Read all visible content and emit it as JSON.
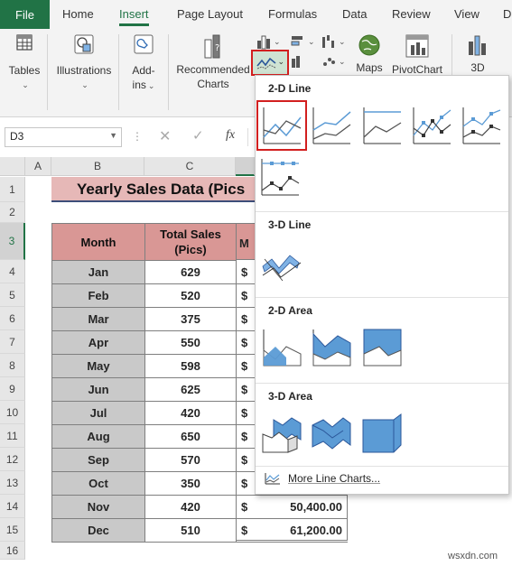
{
  "ribbon_tabs": [
    "File",
    "Home",
    "Insert",
    "Page Layout",
    "Formulas",
    "Data",
    "Review",
    "View",
    "D"
  ],
  "active_tab": "Insert",
  "ribbon": {
    "tables": "Tables",
    "illustrations": "Illustrations",
    "addins_1": "Add-",
    "addins_2": "ins",
    "recommended_1": "Recommended",
    "recommended_2": "Charts",
    "maps": "Maps",
    "pivotchart": "PivotChart",
    "threed": "3D"
  },
  "formula_bar": {
    "name_box": "D3",
    "fx": "fx"
  },
  "columns": [
    "A",
    "B",
    "C"
  ],
  "rows": [
    "1",
    "2",
    "3",
    "4",
    "5",
    "6",
    "7",
    "8",
    "9",
    "10",
    "11",
    "12",
    "13",
    "14",
    "15",
    "16"
  ],
  "sheet": {
    "title": "Yearly Sales Data (Pics",
    "header_month": "Month",
    "header_sales_1": "Total Sales",
    "header_sales_2": "(Pics)",
    "header_partial": "M",
    "rows": [
      {
        "month": "Jan",
        "sales": "629",
        "dollar": "$",
        "amount": ""
      },
      {
        "month": "Feb",
        "sales": "520",
        "dollar": "$",
        "amount": ""
      },
      {
        "month": "Mar",
        "sales": "375",
        "dollar": "$",
        "amount": ""
      },
      {
        "month": "Apr",
        "sales": "550",
        "dollar": "$",
        "amount": ""
      },
      {
        "month": "May",
        "sales": "598",
        "dollar": "$",
        "amount": ""
      },
      {
        "month": "Jun",
        "sales": "625",
        "dollar": "$",
        "amount": ""
      },
      {
        "month": "Jul",
        "sales": "420",
        "dollar": "$",
        "amount": ""
      },
      {
        "month": "Aug",
        "sales": "650",
        "dollar": "$",
        "amount": ""
      },
      {
        "month": "Sep",
        "sales": "570",
        "dollar": "$",
        "amount": ""
      },
      {
        "month": "Oct",
        "sales": "350",
        "dollar": "$",
        "amount": ""
      },
      {
        "month": "Nov",
        "sales": "420",
        "dollar": "$",
        "amount": "50,400.00"
      },
      {
        "month": "Dec",
        "sales": "510",
        "dollar": "$",
        "amount": "61,200.00"
      }
    ]
  },
  "dropdown": {
    "section_2d_line": "2-D Line",
    "section_3d_line": "3-D Line",
    "section_2d_area": "2-D Area",
    "section_3d_area": "3-D Area",
    "more": "More Line Charts..."
  },
  "colors": {
    "excel_green": "#217346",
    "selection_red": "#d21f1f",
    "title_fill": "#e6b8b7",
    "header_fill": "#d99795",
    "month_fill": "#c9c9c9",
    "chart_blue": "#5b9bd5"
  },
  "watermark": "wsxdn.com"
}
